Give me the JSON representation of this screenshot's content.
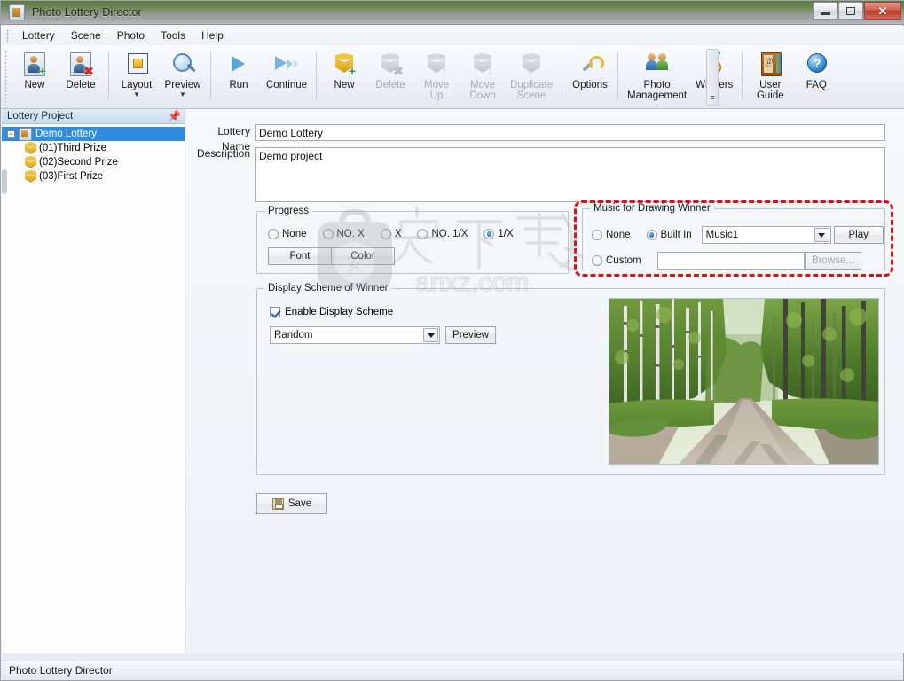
{
  "window": {
    "title": "Photo Lottery Director",
    "icon": "app-icon",
    "buttons": {
      "minimize": "minimize-button",
      "maximize": "maximize-button",
      "close": "✕"
    }
  },
  "menu": {
    "items": [
      {
        "label": "Lottery"
      },
      {
        "label": "Scene"
      },
      {
        "label": "Photo"
      },
      {
        "label": "Tools"
      },
      {
        "label": "Help"
      }
    ]
  },
  "ribbon": {
    "groups": [
      {
        "buttons": [
          {
            "label": "New",
            "icon": "new-lottery-icon",
            "disabled": false,
            "dropdown": false
          },
          {
            "label": "Delete",
            "icon": "delete-lottery-icon",
            "disabled": false,
            "dropdown": false
          }
        ]
      },
      {
        "buttons": [
          {
            "label": "Layout",
            "icon": "layout-icon",
            "disabled": false,
            "dropdown": true
          },
          {
            "label": "Preview",
            "icon": "preview-magnifier-icon",
            "disabled": false,
            "dropdown": true
          }
        ]
      },
      {
        "buttons": [
          {
            "label": "Run",
            "icon": "run-play-icon",
            "disabled": false,
            "dropdown": false
          },
          {
            "label": "Continue",
            "icon": "continue-icon",
            "disabled": false,
            "dropdown": false
          }
        ]
      },
      {
        "buttons": [
          {
            "label": "New",
            "icon": "new-scene-cube-icon",
            "disabled": false,
            "dropdown": false
          },
          {
            "label": "Delete",
            "icon": "delete-scene-icon",
            "disabled": true,
            "dropdown": false
          },
          {
            "label": "Move\nUp",
            "icon": "move-up-icon",
            "disabled": true,
            "dropdown": false
          },
          {
            "label": "Move\nDown",
            "icon": "move-down-icon",
            "disabled": true,
            "dropdown": false
          },
          {
            "label": "Duplicate\nScene",
            "icon": "duplicate-scene-icon",
            "disabled": true,
            "dropdown": false
          }
        ]
      },
      {
        "buttons": [
          {
            "label": "Options",
            "icon": "options-wrench-icon",
            "disabled": false,
            "dropdown": false
          }
        ]
      },
      {
        "buttons": [
          {
            "label": "Photo\nManagement",
            "icon": "photo-management-people-icon",
            "disabled": false,
            "dropdown": false
          },
          {
            "label": "Winners",
            "icon": "winners-medal-icon",
            "disabled": false,
            "dropdown": false
          }
        ]
      },
      {
        "buttons": [
          {
            "label": "User\nGuide",
            "icon": "user-guide-book-icon",
            "disabled": false,
            "dropdown": false
          },
          {
            "label": "FAQ",
            "icon": "faq-icon",
            "disabled": false,
            "dropdown": false
          }
        ]
      }
    ],
    "expand_label": "≡"
  },
  "sidebar": {
    "title": "Lottery Project",
    "pin_icon": "pin-icon",
    "tree": {
      "root": {
        "label": "Demo Lottery",
        "selected": true,
        "expander": "−"
      },
      "children": [
        {
          "label": "(01)Third Prize"
        },
        {
          "label": "(02)Second Prize"
        },
        {
          "label": "(03)First Prize"
        }
      ]
    }
  },
  "form": {
    "lottery_name_label": "Lottery Name",
    "lottery_name_value": "Demo Lottery",
    "description_label": "Description",
    "description_value": "Demo project",
    "progress": {
      "title": "Progress",
      "options": [
        {
          "label": "None",
          "selected": false
        },
        {
          "label": "NO. X",
          "selected": false
        },
        {
          "label": "X",
          "selected": false
        },
        {
          "label": "NO. 1/X",
          "selected": false
        },
        {
          "label": "1/X",
          "selected": true
        }
      ],
      "font_button": "Font",
      "color_button": "Color"
    },
    "music": {
      "title": "Music for Drawing Winner",
      "none_label": "None",
      "none_selected": false,
      "builtin_label": "Built In",
      "builtin_selected": true,
      "builtin_value": "Music1",
      "play_button": "Play",
      "custom_label": "Custom",
      "custom_selected": false,
      "custom_value": "",
      "browse_button": "Browse...",
      "browse_disabled": true,
      "highlight_color": "#d81414"
    },
    "display_scheme": {
      "title": "Display Scheme of Winner",
      "enable_label": "Enable Display Scheme",
      "enable_checked": true,
      "scheme_value": "Random",
      "preview_button": "Preview",
      "photo_alt": "forest-path-photo"
    },
    "save_button": "Save",
    "save_icon": "floppy-disk-icon"
  },
  "watermark": {
    "chinese": "安下载",
    "domain": "anxz.com"
  },
  "statusbar": {
    "text": "Photo Lottery Director"
  }
}
